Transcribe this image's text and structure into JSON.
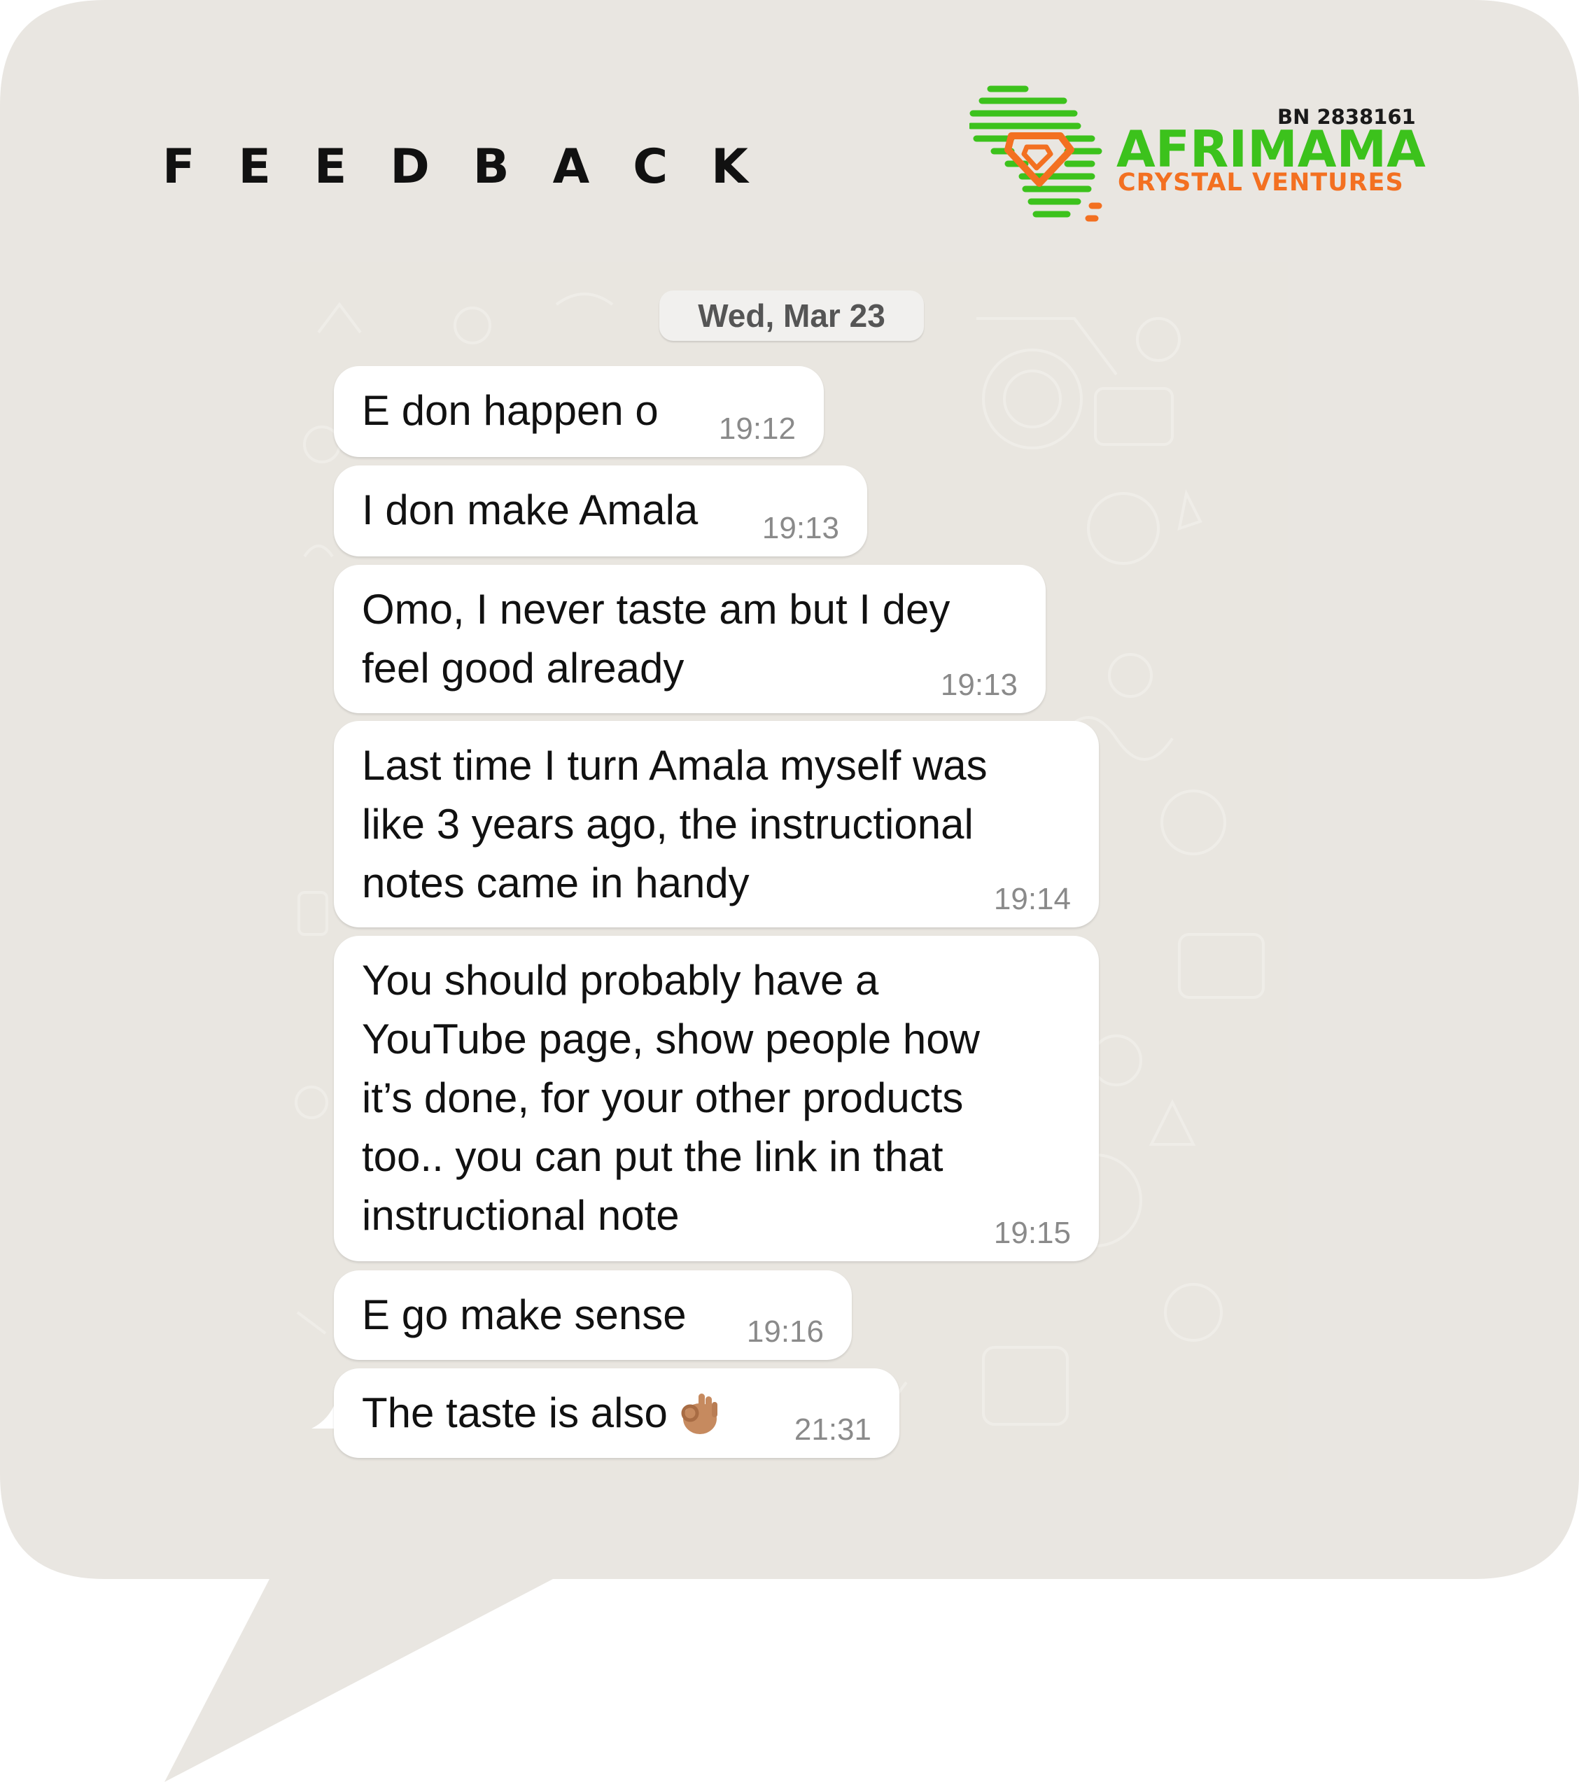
{
  "header": {
    "title": "FEEDBACK"
  },
  "logo": {
    "bn": "BN 2838161",
    "name": "AFRIMAMA",
    "subtitle": "CRYSTAL VENTURES",
    "icon": "africa-map-diamond-icon",
    "colors": {
      "green": "#3cc21c",
      "orange": "#f37021"
    }
  },
  "chat": {
    "date": "Wed, Mar 23",
    "messages": [
      {
        "text": "E don happen o",
        "time": "19:12"
      },
      {
        "text": "I don make Amala",
        "time": "19:13"
      },
      {
        "text": "Omo, I never taste am but I dey\nfeel good already",
        "time": "19:13"
      },
      {
        "text": "Last time I turn Amala myself was\nlike 3 years ago, the instructional\nnotes came in handy",
        "time": "19:14"
      },
      {
        "text": "You should probably have a\nYouTube page, show people how\nit’s done, for your other products\ntoo.. you can put the link in that\ninstructional note",
        "time": "19:15"
      },
      {
        "text": "E go make sense",
        "time": "19:16"
      },
      {
        "text": "The taste is also",
        "time": "21:31",
        "emoji": "ok-hand-emoji"
      }
    ]
  },
  "colors": {
    "bubble_background": "#e9e6e1",
    "chat_background": "#e9e6e0",
    "message_bubble": "#ffffff"
  }
}
